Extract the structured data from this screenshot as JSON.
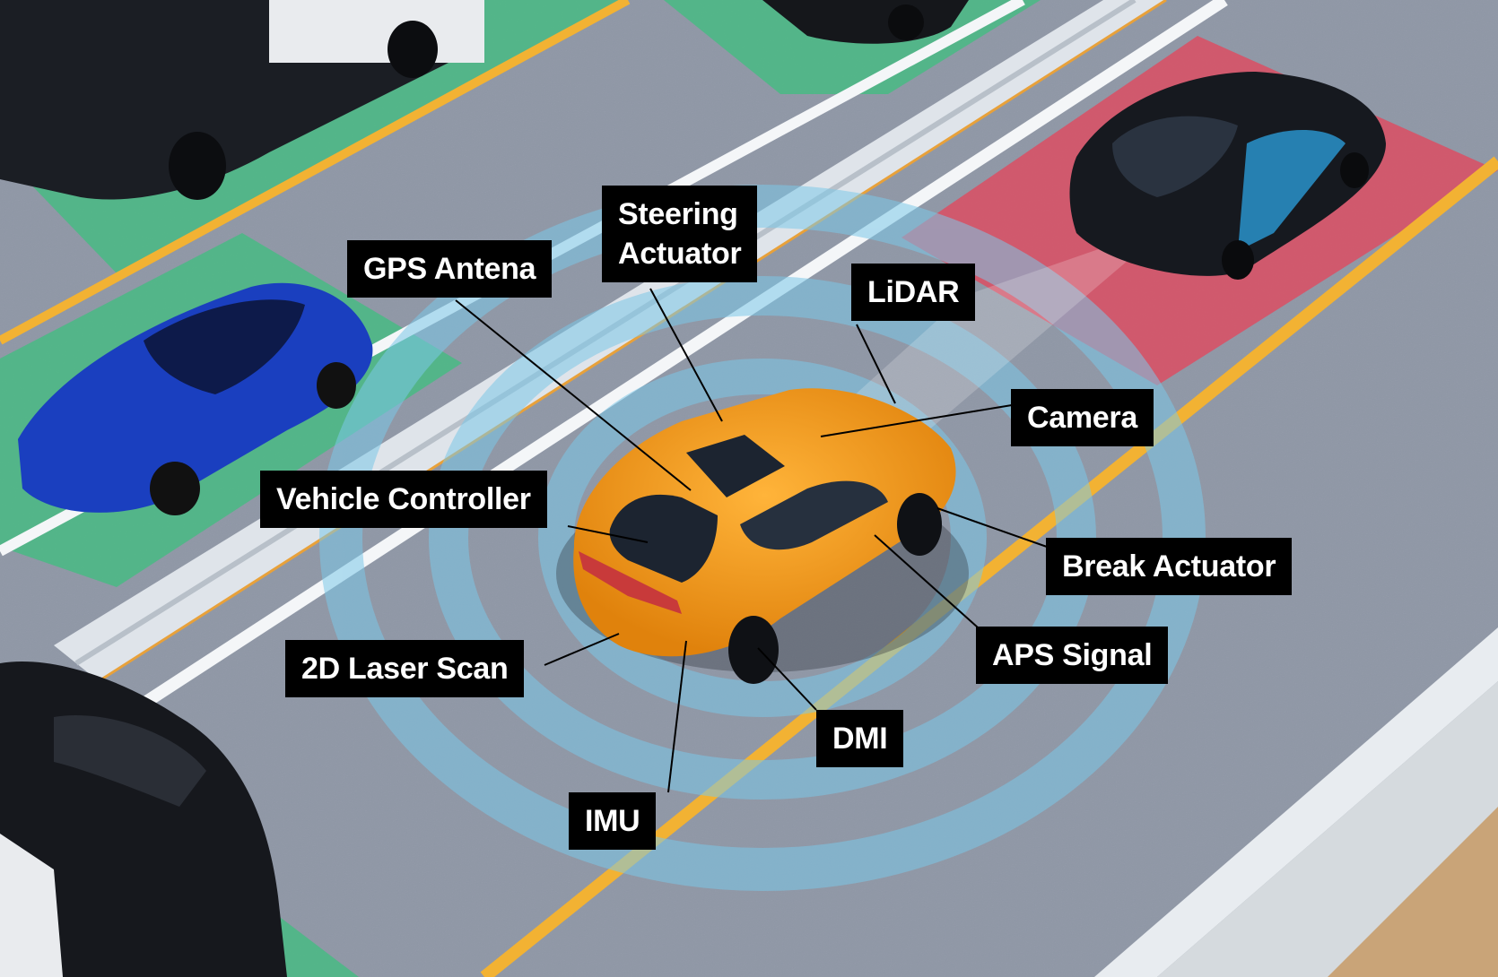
{
  "diagram": {
    "type": "autonomous-vehicle-sensor-callout",
    "subject": "Orange SUV self-driving car on highway",
    "colors": {
      "road": "#8f97a6",
      "lane_yellow": "#f2b233",
      "lane_white": "#f4f6f8",
      "safe_zone_green": "#3fbf7f",
      "danger_zone_red": "#e04a5f",
      "sensor_wave_blue": "#7cc8e8",
      "label_bg": "#000000",
      "label_text": "#ffffff",
      "car_orange": "#f59a1c"
    },
    "labels": [
      {
        "id": "gps-antena",
        "text": "GPS Antena"
      },
      {
        "id": "steering-actuator",
        "text": "Steering Actuator",
        "lines": [
          "Steering",
          "Actuator"
        ]
      },
      {
        "id": "lidar",
        "text": "LiDAR"
      },
      {
        "id": "camera",
        "text": "Camera"
      },
      {
        "id": "vehicle-controller",
        "text": "Vehicle Controller"
      },
      {
        "id": "break-actuator",
        "text": "Break Actuator"
      },
      {
        "id": "aps-signal",
        "text": "APS Signal"
      },
      {
        "id": "2d-laser-scan",
        "text": "2D Laser Scan"
      },
      {
        "id": "dmi",
        "text": "DMI"
      },
      {
        "id": "imu",
        "text": "IMU"
      }
    ]
  }
}
